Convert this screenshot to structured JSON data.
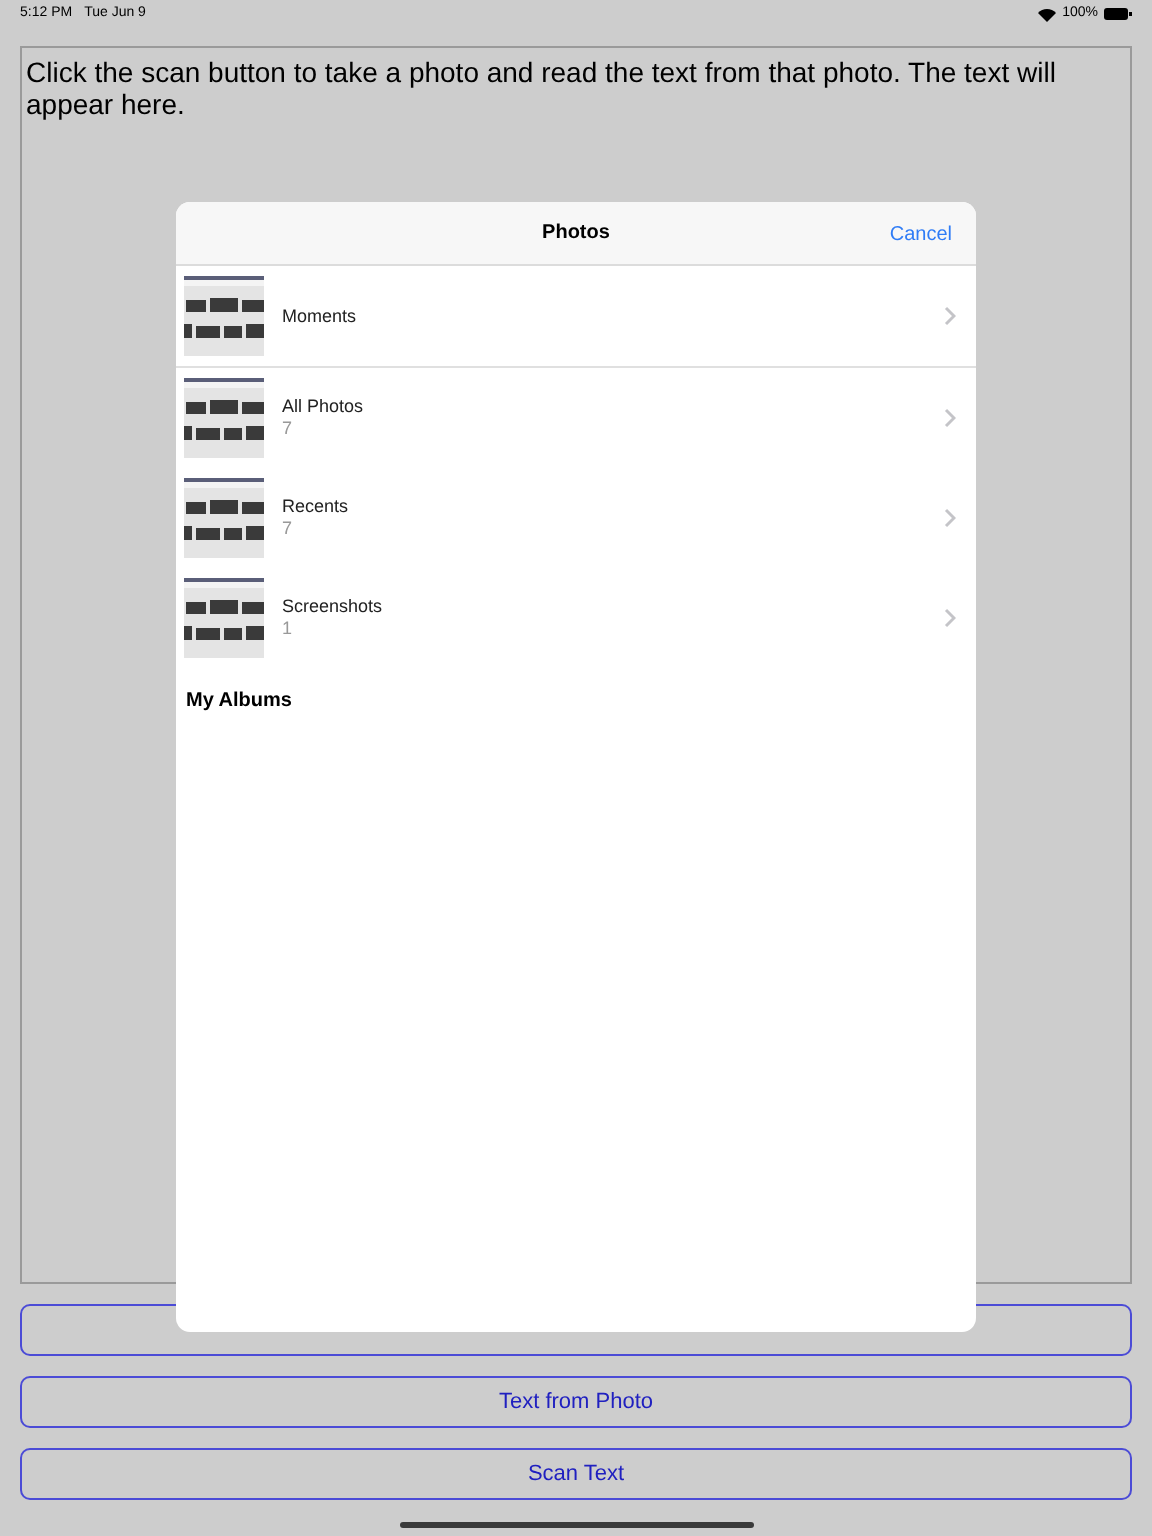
{
  "status_bar": {
    "time": "5:12 PM",
    "date": "Tue Jun 9",
    "battery": "100%"
  },
  "text_view": {
    "text": "Click the scan button to take a photo and read the text from that photo.  The text will appear here."
  },
  "buttons": [
    {
      "kind": "covered"
    },
    {
      "kind": "labeled",
      "label": "Text from Photo"
    },
    {
      "kind": "labeled",
      "label": "Scan Text"
    }
  ],
  "photos_sheet": {
    "title": "Photos",
    "cancel": "Cancel",
    "albums": [
      {
        "kind": "picture",
        "name": "Moments"
      },
      {
        "kind": "picture",
        "name": "All Photos",
        "count": "7"
      },
      {
        "kind": "picture",
        "name": "Recents",
        "count": "7"
      },
      {
        "kind": "picture",
        "name": "Screenshots",
        "count": "1"
      }
    ],
    "section_heading": "My Albums"
  }
}
